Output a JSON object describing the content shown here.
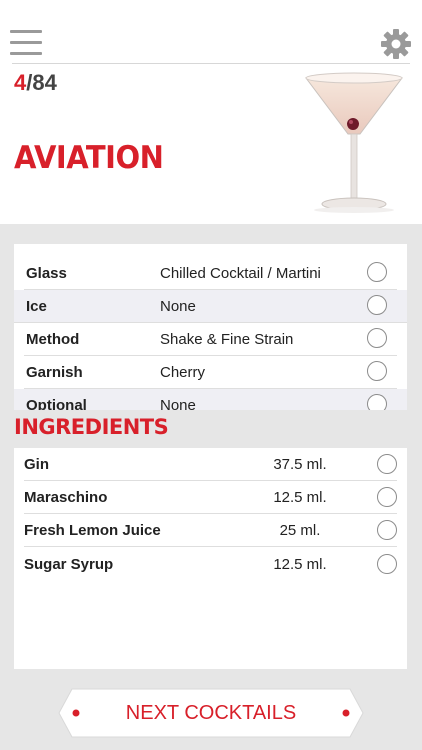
{
  "header": {
    "counter_current": "4",
    "counter_total": "/84",
    "title": "AVIATION"
  },
  "details": [
    {
      "label": "Glass",
      "value": "Chilled Cocktail / Martini"
    },
    {
      "label": "Ice",
      "value": "None"
    },
    {
      "label": "Method",
      "value": "Shake & Fine Strain"
    },
    {
      "label": "Garnish",
      "value": "Cherry"
    },
    {
      "label": "Optional",
      "value": "None"
    }
  ],
  "ingredients_heading": "INGREDIENTS",
  "ingredients": [
    {
      "name": "Gin",
      "amount": "37.5 ml."
    },
    {
      "name": "Maraschino",
      "amount": "12.5 ml."
    },
    {
      "name": "Fresh Lemon Juice",
      "amount": "25 ml."
    },
    {
      "name": "Sugar Syrup",
      "amount": "12.5 ml."
    }
  ],
  "next_button": "NEXT COCKTAILS",
  "colors": {
    "accent": "#d8202a",
    "background": "#e6e6e6",
    "row_shade": "#efeff4"
  },
  "icons": [
    "hamburger-menu-icon",
    "gear-icon",
    "martini-glass-image",
    "radio-button"
  ]
}
